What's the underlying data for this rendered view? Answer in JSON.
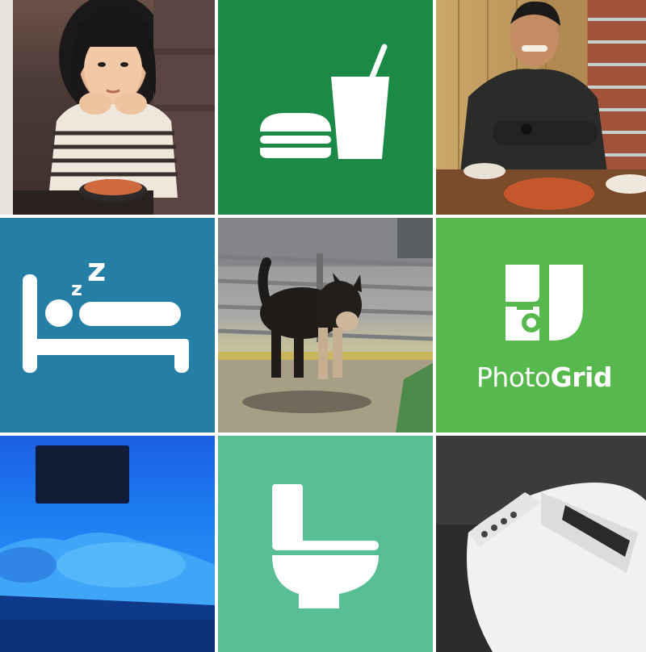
{
  "collage": {
    "tiles": [
      {
        "kind": "photo",
        "subject": "girl-with-soup"
      },
      {
        "kind": "icon",
        "icon": "burger-and-drink-icon",
        "color": "#1b8a47"
      },
      {
        "kind": "photo",
        "subject": "laughing-man"
      },
      {
        "kind": "icon",
        "icon": "sleeping-bed-icon",
        "color": "#257ea4"
      },
      {
        "kind": "photo",
        "subject": "husky-dog"
      },
      {
        "kind": "logo",
        "color": "#57b84e"
      },
      {
        "kind": "photo",
        "subject": "person-sleeping-blue-light"
      },
      {
        "kind": "icon",
        "icon": "toilet-icon",
        "color": "#57bf93"
      },
      {
        "kind": "photo",
        "subject": "bidet-toilet-seat"
      }
    ]
  },
  "logo": {
    "text_light": "Photo",
    "text_bold": "Grid",
    "icon": "photogrid-logo-icon"
  },
  "colors": {
    "food": "#1b8a47",
    "sleep": "#257ea4",
    "logo": "#57b84e",
    "toilet": "#57bf93",
    "icon_fill": "#ffffff"
  }
}
